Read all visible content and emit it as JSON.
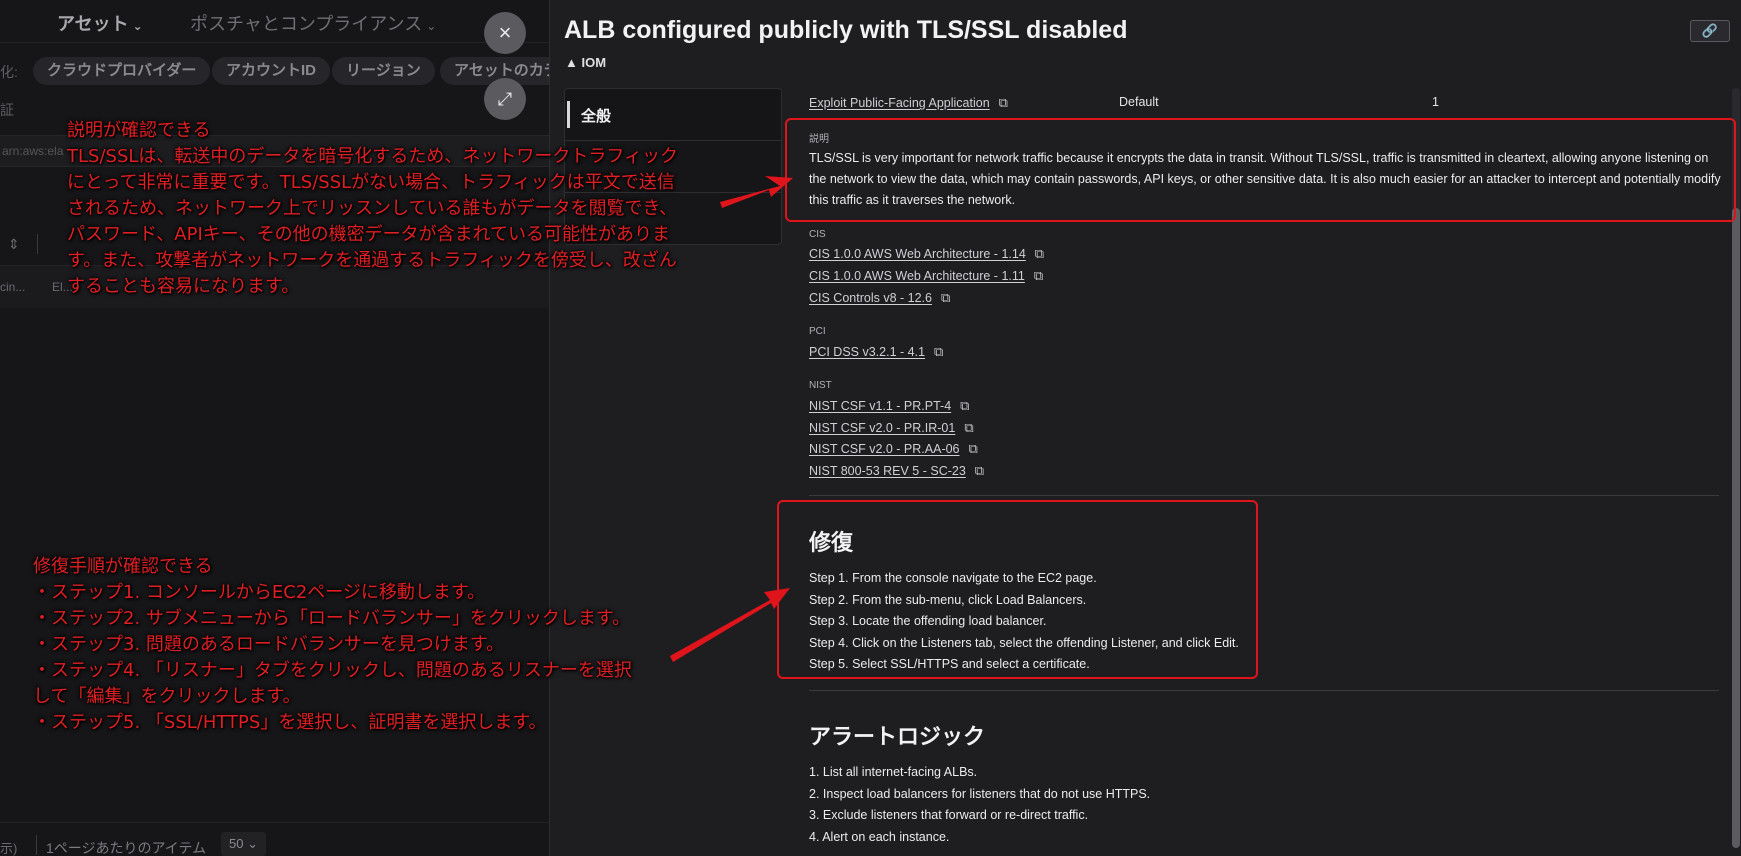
{
  "background_app": {
    "nav_tabs": [
      {
        "label": "アセット",
        "active": true
      },
      {
        "label": "ポスチャとコンプライアンス",
        "active": false
      }
    ],
    "filter_label": "化:",
    "filter_chips": [
      "クラウドプロバイダー",
      "アカウントID",
      "リージョン",
      "アセットのカテ"
    ],
    "sub_label": "証",
    "search_text": "arn:aws:ela",
    "row_cells": [
      "cin...",
      "El..."
    ],
    "footer": {
      "left_text": "示)",
      "items_per_page_label": "1ページあたりのアイテム",
      "page_size": "50"
    }
  },
  "close_button_icon": "close-icon",
  "expand_button_icon": "expand-icon",
  "panel": {
    "title": "ALB configured publicly with TLS/SSL disabled",
    "tag": "IOM",
    "nav_items": [
      {
        "label": "全般",
        "active": true
      },
      {
        "label": "",
        "active": false
      },
      {
        "label": "",
        "active": false
      }
    ],
    "mitre_row": {
      "technique": "Exploit Public-Facing Application",
      "tactic_value": "Default",
      "count": "1"
    },
    "description": {
      "heading": "説明",
      "text": "TLS/SSL is very important for network traffic because it encrypts the data in transit. Without TLS/SSL, traffic is transmitted in cleartext, allowing anyone listening on the network to view the data, which may contain passwords, API keys, or other sensitive data. It is also much easier for an attacker to intercept and potentially modify this traffic as it traverses the network."
    },
    "compliance": [
      {
        "group": "CIS",
        "links": [
          "CIS 1.0.0 AWS Web Architecture - 1.14",
          "CIS 1.0.0 AWS Web Architecture - 1.11",
          "CIS Controls v8 - 12.6"
        ]
      },
      {
        "group": "PCI",
        "links": [
          "PCI DSS v3.2.1 - 4.1"
        ]
      },
      {
        "group": "NIST",
        "links": [
          "NIST CSF v1.1 - PR.PT-4",
          "NIST CSF v2.0 - PR.IR-01",
          "NIST CSF v2.0 - PR.AA-06",
          "NIST 800-53 REV 5 - SC-23"
        ]
      }
    ],
    "remediation": {
      "heading": "修復",
      "steps": [
        "Step 1. From the console navigate to the EC2 page.",
        "Step 2. From the sub-menu, click Load Balancers.",
        "Step 3. Locate the offending load balancer.",
        "Step 4. Click on the Listeners tab, select the offending Listener, and click Edit.",
        "Step 5. Select SSL/HTTPS and select a certificate."
      ]
    },
    "alert_logic": {
      "heading": "アラートロジック",
      "steps": [
        "1. List all internet-facing ALBs.",
        "2. Inspect load balancers for listeners that do not use HTTPS.",
        "3. Exclude listeners that forward or re-direct traffic.",
        "4. Alert on each instance."
      ]
    }
  },
  "annotations": {
    "description_note": "説明が確認できる\nTLS/SSLは、転送中のデータを暗号化するため、ネットワークトラフィック\nにとって非常に重要です。TLS/SSLがない場合、トラフィックは平文で送信\nされるため、ネットワーク上でリッスンしている誰もがデータを閲覧でき、\nパスワード、APIキー、その他の機密データが含まれている可能性がありま\nす。また、攻撃者がネットワークを通過するトラフィックを傍受し、改ざん\nすることも容易になります。",
    "remediation_note": "修復手順が確認できる\n・ステップ1. コンソールからEC2ページに移動します。\n・ステップ2. サブメニューから「ロードバランサー」をクリックします。\n・ステップ3. 問題のあるロードバランサーを見つけます。\n・ステップ4. 「リスナー」タブをクリックし、問題のあるリスナーを選択\nして「編集」をクリックします。\n・ステップ5. 「SSL/HTTPS」を選択し、証明書を選択します。",
    "color": "#e0141b"
  }
}
